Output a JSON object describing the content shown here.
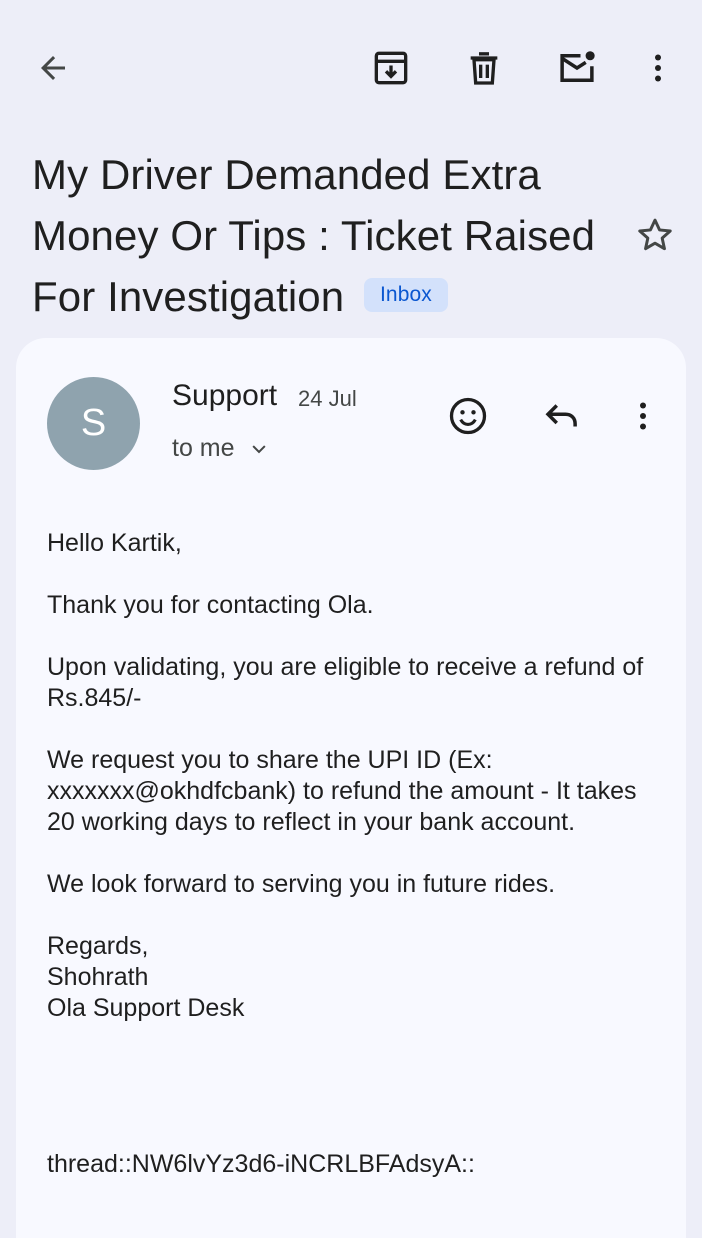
{
  "toolbar": {
    "back_icon": "arrow-left-icon",
    "archive_icon": "archive-icon",
    "delete_icon": "trash-icon",
    "mark_unread_icon": "mail-unread-icon",
    "more_icon": "more-vert-icon"
  },
  "email": {
    "subject": "My Driver Demanded Extra Money Or Tips : Ticket Raised For Investigation",
    "label": "Inbox",
    "starred": false,
    "sender": {
      "initial": "S",
      "name": "Support",
      "date": "24 Jul",
      "recipient": "to me"
    },
    "body": [
      "Hello Kartik,",
      "Thank you for contacting Ola.",
      "Upon validating, you are eligible to receive a refund of Rs.845/-",
      "We request you to share the UPI ID (Ex: xxxxxxx@okhdfcbank) to refund the amount - It takes 20 working days to reflect in your bank account.",
      "We look forward to serving you in future rides."
    ],
    "signature": [
      "Regards,",
      "Shohrath",
      "Ola Support Desk"
    ],
    "thread_id": "thread::NW6lvYz3d6-iNCRLBFAdsyA::"
  },
  "colors": {
    "background": "#edeef8",
    "card": "#f8f9ff",
    "label_bg": "#d3e1fb",
    "label_text": "#0b57d0",
    "avatar": "#8fa3ae"
  }
}
